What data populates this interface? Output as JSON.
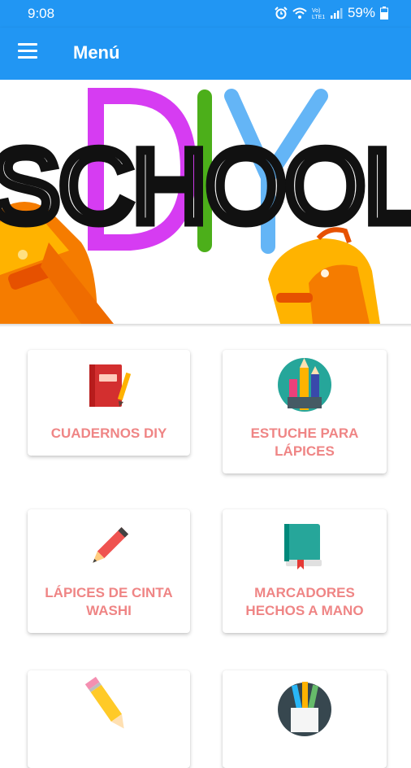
{
  "status_bar": {
    "time": "9:08",
    "battery": "59%",
    "icons": [
      "alarm-icon",
      "wifi-icon",
      "volte-icon",
      "signal-icon",
      "battery-icon"
    ]
  },
  "app_bar": {
    "title": "Menú",
    "menu_icon": "hamburger-menu-icon"
  },
  "banner": {
    "word_top": "DIY",
    "word_main": "SCHOOL",
    "colors": {
      "d": "#d63cf2",
      "i": "#4caf1a",
      "y": "#64b5f6",
      "backpack": "#f57c00"
    }
  },
  "cards": [
    {
      "line1": "CUADERNOS DIY",
      "line2": "",
      "icon": "notebook-icon"
    },
    {
      "line1": "ESTUCHE PARA",
      "line2": "LÁPICES",
      "icon": "pencil-case-icon"
    },
    {
      "line1": "LÁPICES DE CINTA",
      "line2": "WASHI",
      "icon": "pencil-icon"
    },
    {
      "line1": "MARCADORES",
      "line2": "HECHOS A MANO",
      "icon": "book-icon"
    },
    {
      "line1": "",
      "line2": "",
      "icon": "yellow-pencil-icon"
    },
    {
      "line1": "",
      "line2": "",
      "icon": "pencil-cup-icon"
    }
  ],
  "colors": {
    "primary": "#2196f3",
    "label": "#ef8585"
  }
}
